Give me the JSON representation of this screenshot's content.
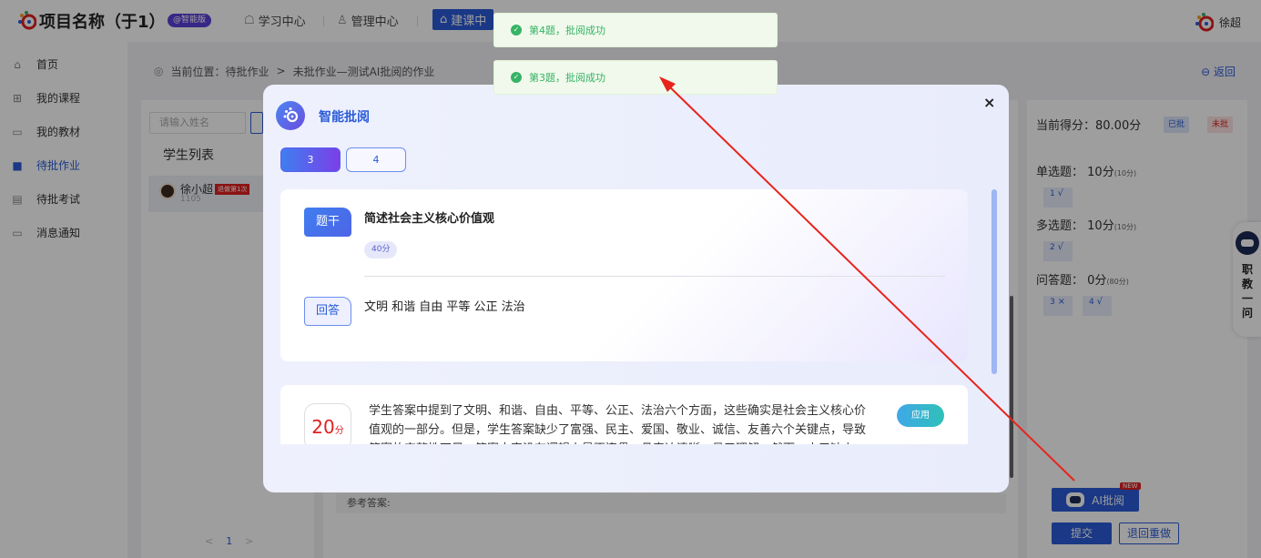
{
  "header": {
    "project_title": "项目名称（于1）",
    "edition_badge": "@智能版",
    "nav": [
      {
        "label": "学习中心",
        "icon": "graduation-icon"
      },
      {
        "label": "管理中心",
        "icon": "user-icon"
      },
      {
        "label": "建课中",
        "icon": "build-icon"
      }
    ],
    "user_name": "徐超"
  },
  "sidebar": {
    "items": [
      {
        "label": "首页",
        "icon": "home-icon"
      },
      {
        "label": "我的课程",
        "icon": "book-icon"
      },
      {
        "label": "我的教材",
        "icon": "chat-icon"
      },
      {
        "label": "待批作业",
        "icon": "homework-icon",
        "active": true
      },
      {
        "label": "待批考试",
        "icon": "exam-icon"
      },
      {
        "label": "消息通知",
        "icon": "message-icon"
      }
    ]
  },
  "breadcrumb": {
    "prefix": "当前位置：",
    "level1": "待批作业",
    "separator": ">",
    "level2": "未批作业—测试AI批阅的作业",
    "back": "返回"
  },
  "student_list": {
    "search_placeholder": "请输入姓名",
    "title": "学生列表",
    "students": [
      {
        "name": "徐小超",
        "id": "1105",
        "badge": "退做第1次"
      }
    ],
    "pager": {
      "prev": "<",
      "current": "1",
      "next": ">"
    }
  },
  "center": {
    "ref_answer_label": "参考答案:"
  },
  "score_panel": {
    "current_score_label": "当前得分：80.00分",
    "tag_done": "已批",
    "tag_undone": "未批",
    "sections": [
      {
        "label": "单选题：",
        "score": "10分",
        "total": "(10分)",
        "questions": [
          {
            "num": "1",
            "mark": "√"
          }
        ]
      },
      {
        "label": "多选题：",
        "score": "10分",
        "total": "(10分)",
        "questions": [
          {
            "num": "2",
            "mark": "√"
          }
        ]
      },
      {
        "label": "问答题：",
        "score": "0分",
        "total": "(80分)",
        "questions": [
          {
            "num": "3",
            "mark": "×"
          },
          {
            "num": "4",
            "mark": "√"
          }
        ]
      }
    ],
    "ai_button": "AI批阅",
    "new_badge": "NEW",
    "submit": "提交",
    "return_redo": "退回重做"
  },
  "float_widget": {
    "text": "职教一问"
  },
  "dialog": {
    "title": "智能批阅",
    "close": "×",
    "tabs": [
      "3",
      "4"
    ],
    "stem_label": "题干",
    "stem_text": "简述社会主义核心价值观",
    "points": "40分",
    "answer_label": "回答",
    "answer_text": "文明 和谐 自由 平等 公正 法治",
    "ai_score": "20",
    "ai_score_unit": "分",
    "ai_comment": "学生答案中提到了文明、和谐、自由、平等、公正、法治六个方面，这些确实是社会主义核心价值观的一部分。但是，学生答案缺少了富强、民主、爱国、敬业、诚信、友善六个关键点，导致答案的完整性不足。答案内容没有逻辑上是否连贯，且表达清晰，易于理解。然而，由于缺少",
    "apply": "应用"
  },
  "toasts": [
    {
      "text": "第4题，批阅成功"
    },
    {
      "text": "第3题，批阅成功"
    }
  ],
  "colors": {
    "primary": "#2a5bd7",
    "success": "#36b366",
    "danger": "#e02020",
    "annotation_arrow": "#e8231c"
  }
}
